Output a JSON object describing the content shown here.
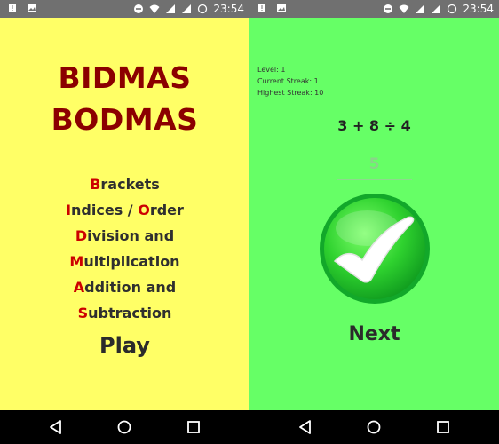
{
  "status": {
    "time": "23:54"
  },
  "left_screen": {
    "title_line1": "BIDMAS",
    "title_line2": "BODMAS",
    "rules": [
      {
        "first": "B",
        "rest": "rackets"
      },
      {
        "first": "I",
        "rest": "ndices / ",
        "first2": "O",
        "rest2": "rder"
      },
      {
        "first": "D",
        "rest": "ivision and"
      },
      {
        "first": "M",
        "rest": "ultiplication"
      },
      {
        "first": "A",
        "rest": "ddition and"
      },
      {
        "first": "S",
        "rest": "ubtraction"
      }
    ],
    "play_label": "Play"
  },
  "right_screen": {
    "level": "Level: 1",
    "current_streak": "Current Streak: 1",
    "highest_streak": "Highest Streak: 10",
    "problem": "3 + 8 ÷ 4",
    "answer": "5",
    "next_label": "Next"
  },
  "colors": {
    "left_bg": "#ffff66",
    "right_bg": "#66ff66",
    "title": "#8b0000",
    "rule_initial": "#cc0000"
  },
  "icons": [
    "notification-icon",
    "image-icon",
    "dnd-icon",
    "wifi-icon",
    "signal-icon",
    "battery-icon",
    "back-icon",
    "home-icon",
    "recents-icon",
    "checkmark-icon"
  ]
}
